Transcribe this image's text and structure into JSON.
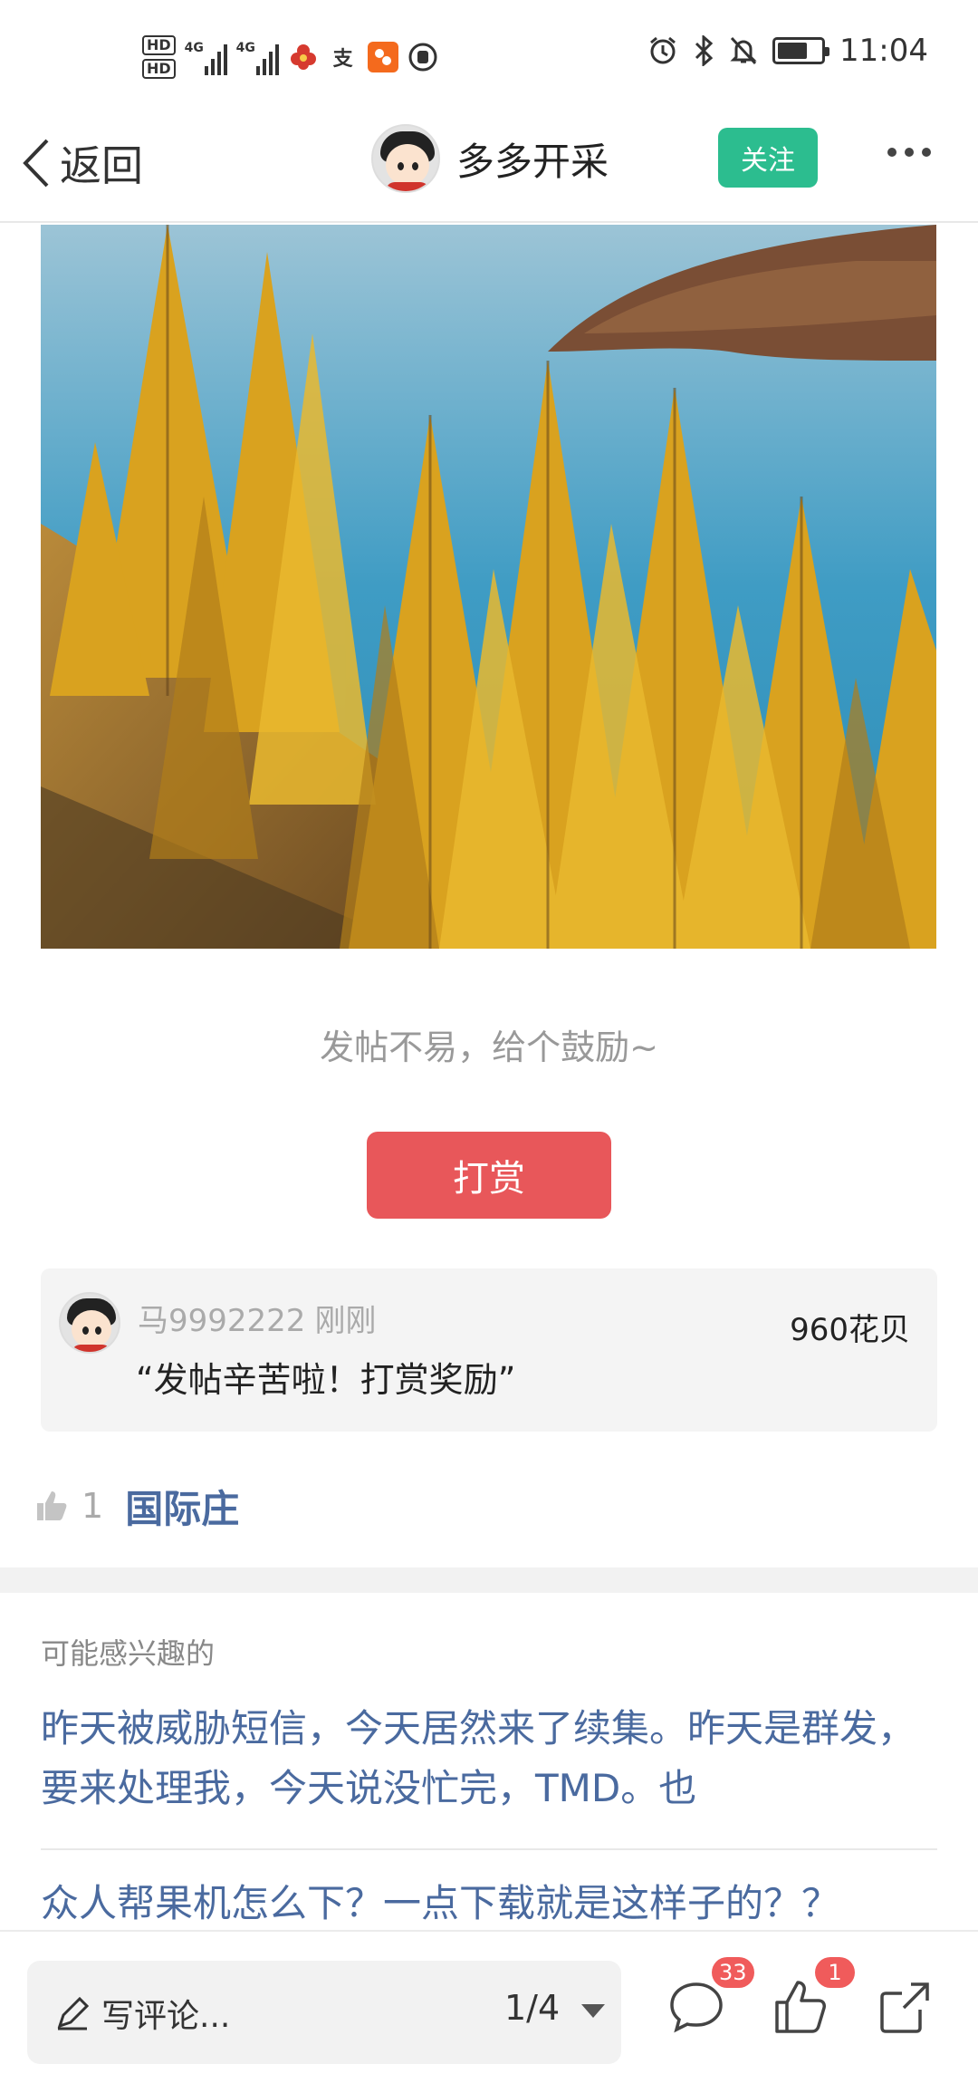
{
  "status_bar": {
    "hd1": "HD",
    "hd2": "HD",
    "net1": "4G",
    "net2": "4G",
    "alipay_glyph": "支",
    "time": "11:04",
    "icons": [
      "alarm-icon",
      "bluetooth-icon",
      "mute-icon",
      "battery-icon"
    ],
    "battery_level": 0.7
  },
  "nav": {
    "back_label": "返回",
    "author_name": "多多开采",
    "follow_label": "关注"
  },
  "post": {
    "encourage_text": "发帖不易，给个鼓励~",
    "reward_button": "打赏"
  },
  "reward_record": {
    "user": "马9992222",
    "time": "刚刚",
    "message": "“发帖辛苦啦！打赏奖励”",
    "amount": "960花贝"
  },
  "likes": {
    "count": "1",
    "liker": "国际庄"
  },
  "recommend": {
    "title": "可能感兴趣的",
    "items": [
      "昨天被威胁短信，今天居然来了续集。昨天是群发，要来处理我，今天说没忙完，TMD。也",
      "众人帮果机怎么下？一点下载就是这样子的？？"
    ]
  },
  "bottom_bar": {
    "comment_placeholder": "写评论...",
    "page_indicator": "1/4",
    "comment_count": "33",
    "like_count": "1"
  },
  "colors": {
    "follow_green": "#2cbd8f",
    "reward_red": "#e8575a",
    "link_blue": "#4a6a9f",
    "badge_red": "#f05b5b"
  }
}
